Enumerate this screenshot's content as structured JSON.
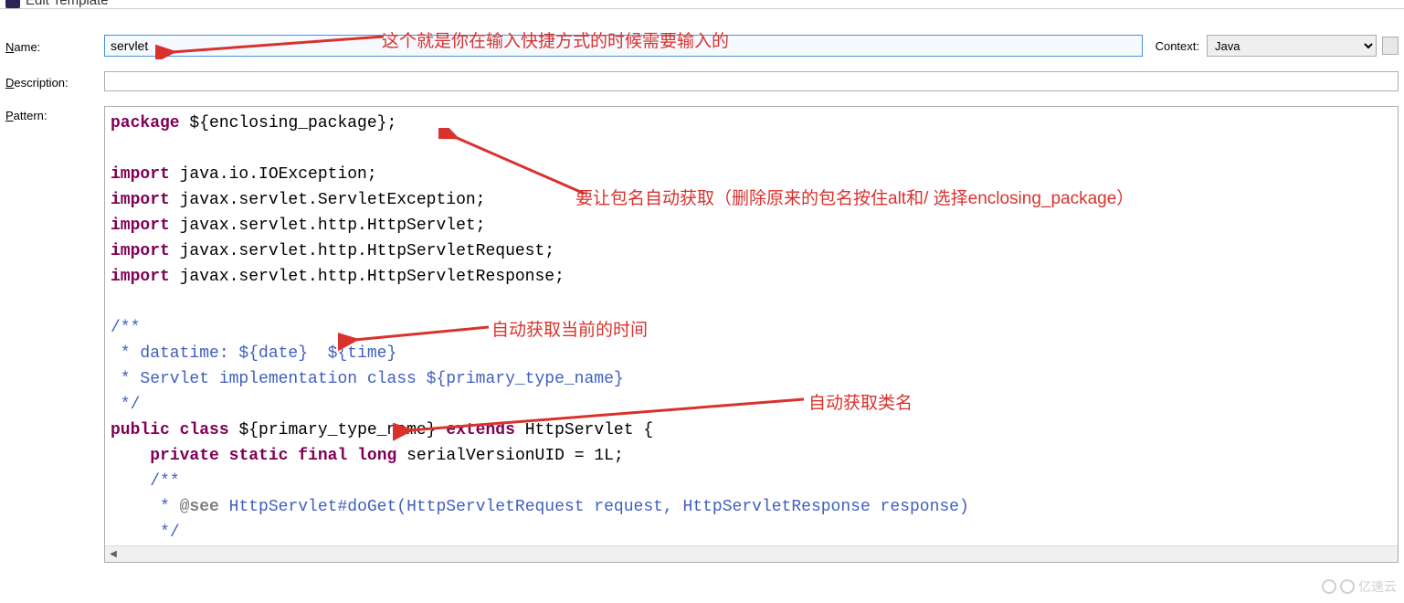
{
  "window": {
    "title": "Edit Template"
  },
  "labels": {
    "name": "Name:",
    "name_u": "N",
    "context": "Context:",
    "context_u": "C",
    "description": "Description:",
    "description_u": "D",
    "pattern": "Pattern:",
    "pattern_u": "P"
  },
  "fields": {
    "name_value": "servlet",
    "context_value": "Java",
    "description_value": ""
  },
  "pattern_lines": [
    [
      {
        "c": "kw",
        "t": "package"
      },
      {
        "t": " ${enclosing_package};"
      }
    ],
    [],
    [
      {
        "c": "kw",
        "t": "import"
      },
      {
        "t": " java.io.IOException;"
      }
    ],
    [
      {
        "c": "kw",
        "t": "import"
      },
      {
        "t": " javax.servlet.ServletException;"
      }
    ],
    [
      {
        "c": "kw",
        "t": "import"
      },
      {
        "t": " javax.servlet.http.HttpServlet;"
      }
    ],
    [
      {
        "c": "kw",
        "t": "import"
      },
      {
        "t": " javax.servlet.http.HttpServletRequest;"
      }
    ],
    [
      {
        "c": "kw",
        "t": "import"
      },
      {
        "t": " javax.servlet.http.HttpServletResponse;"
      }
    ],
    [],
    [
      {
        "c": "jc",
        "t": "/**"
      }
    ],
    [
      {
        "c": "jc",
        "t": " * datatime: ${date}  ${time}"
      }
    ],
    [
      {
        "c": "jc",
        "t": " * Servlet implementation class ${primary_type_name}"
      }
    ],
    [
      {
        "c": "jc",
        "t": " */"
      }
    ],
    [
      {
        "c": "kw",
        "t": "public"
      },
      {
        "t": " "
      },
      {
        "c": "kw",
        "t": "class"
      },
      {
        "t": " ${primary_type_name} "
      },
      {
        "c": "kw",
        "t": "extends"
      },
      {
        "t": " HttpServlet {"
      }
    ],
    [
      {
        "t": "    "
      },
      {
        "c": "kw",
        "t": "private"
      },
      {
        "t": " "
      },
      {
        "c": "kw",
        "t": "static"
      },
      {
        "t": " "
      },
      {
        "c": "kw",
        "t": "final"
      },
      {
        "t": " "
      },
      {
        "c": "kw",
        "t": "long"
      },
      {
        "t": " serialVersionUID = 1L;"
      }
    ],
    [
      {
        "t": "    "
      },
      {
        "c": "jc",
        "t": "/**"
      }
    ],
    [
      {
        "t": "    "
      },
      {
        "c": "jc",
        "t": " * "
      },
      {
        "c": "jt",
        "t": "@see"
      },
      {
        "c": "jc",
        "t": " HttpServlet#doGet(HttpServletRequest request, HttpServletResponse response)"
      }
    ],
    [
      {
        "t": "    "
      },
      {
        "c": "jc",
        "t": " */"
      }
    ]
  ],
  "annotations": {
    "note1": "这个就是你在输入快捷方式的时候需要输入的",
    "note2": "要让包名自动获取（删除原来的包名按住alt和/ 选择enclosing_package）",
    "note3": "自动获取当前的时间",
    "note4": "自动获取类名"
  },
  "watermark": "亿速云"
}
